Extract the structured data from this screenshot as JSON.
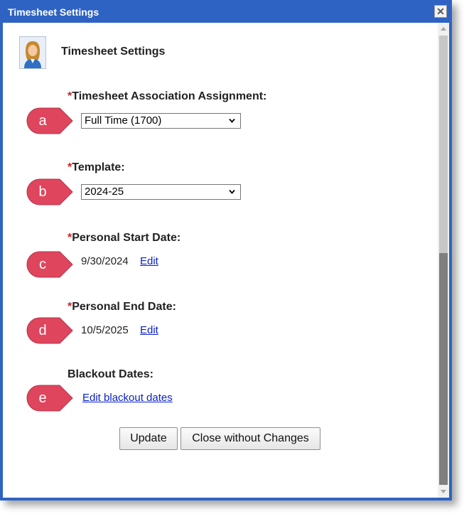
{
  "window": {
    "title": "Timesheet Settings",
    "close_glyph": "✕"
  },
  "header": {
    "title": "Timesheet Settings",
    "icon": "user-avatar-icon"
  },
  "required_marker": "*",
  "fields": {
    "assignment": {
      "label": "Timesheet Association Assignment:",
      "value": "Full Time (1700)"
    },
    "template": {
      "label": "Template:",
      "value": "2024-25"
    },
    "start_date": {
      "label": "Personal Start Date:",
      "value": "9/30/2024",
      "edit": "Edit"
    },
    "end_date": {
      "label": "Personal End Date:",
      "value": "10/5/2025",
      "edit": "Edit"
    },
    "blackout": {
      "label": "Blackout Dates:",
      "link": "Edit blackout dates"
    }
  },
  "callouts": [
    "a",
    "b",
    "c",
    "d",
    "e"
  ],
  "buttons": {
    "update": "Update",
    "close": "Close without Changes"
  },
  "colors": {
    "titlebar": "#2e63c4",
    "callout": "#e0455e",
    "required": "#d11f1f",
    "link": "#0a21c8"
  }
}
